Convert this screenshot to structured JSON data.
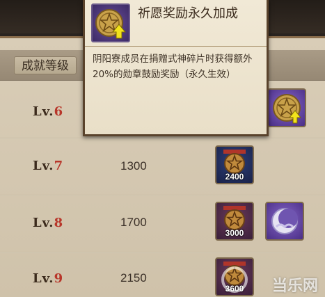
{
  "table": {
    "level_header": "成就等级"
  },
  "rows": [
    {
      "prefix": "Lv.",
      "level": "6",
      "amount": "",
      "rewards": [
        {
          "icon": "gold-coin-arrow-icon",
          "count": ""
        }
      ]
    },
    {
      "prefix": "Lv.",
      "level": "7",
      "amount": "1300",
      "rewards": [
        {
          "icon": "star-medal-icon",
          "count": "2400"
        }
      ]
    },
    {
      "prefix": "Lv.",
      "level": "8",
      "amount": "1700",
      "rewards": [
        {
          "icon": "star-medal-icon",
          "count": "3000"
        },
        {
          "icon": "moon-cloud-icon",
          "count": ""
        }
      ]
    },
    {
      "prefix": "Lv.",
      "level": "9",
      "amount": "2150",
      "rewards": [
        {
          "icon": "star-medal-icon",
          "count": "3600"
        }
      ]
    }
  ],
  "tooltip": {
    "title": "祈愿奖励永久加成",
    "description": "阴阳寮成员在捐赠式神碎片时获得额外20%的勋章鼓励奖励（永久生效）",
    "icon": "gold-coin-arrow-icon"
  },
  "watermark": "当乐网",
  "colors": {
    "level_number": "#b8362a",
    "panel": "#d9cdb7",
    "tooltip_border": "#5a432c"
  }
}
